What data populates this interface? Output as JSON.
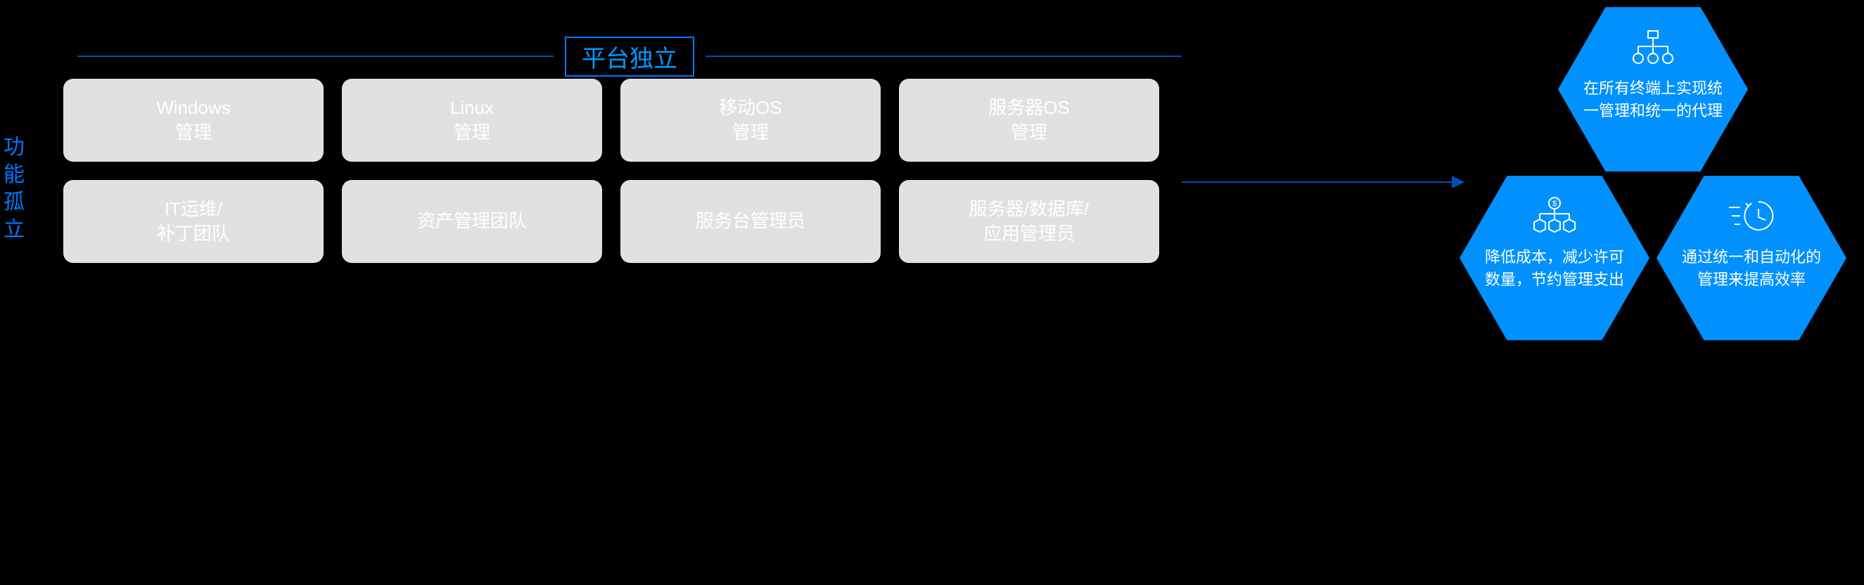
{
  "colors": {
    "accent_blue": "#0078ff",
    "bright_blue": "#0099ff",
    "line_blue": "#0050b3",
    "hex_blue": "#0091ff",
    "card_grey": "#e1e1e1",
    "bg_black": "#000000"
  },
  "sidebar": {
    "vertical_label": "功能孤立"
  },
  "heading": {
    "label": "平台独立"
  },
  "cards": {
    "row1": [
      {
        "line1": "Windows",
        "line2": "管理"
      },
      {
        "line1": "Linux",
        "line2": "管理"
      },
      {
        "line1": "移动OS",
        "line2": "管理"
      },
      {
        "line1": "服务器OS",
        "line2": "管理"
      }
    ],
    "row2": [
      {
        "line1": "IT运维/",
        "line2": "补丁团队"
      },
      {
        "line1": "资产管理团队",
        "line2": ""
      },
      {
        "line1": "服务台管理员",
        "line2": ""
      },
      {
        "line1": "服务器/数据库/",
        "line2": "应用管理员"
      }
    ]
  },
  "hex": {
    "top": {
      "icon": "org-chart-icon",
      "text": "在所有终端上实现统一管理和统一的代理"
    },
    "left": {
      "icon": "cost-boxes-icon",
      "text": "降低成本，减少许可数量，节约管理支出"
    },
    "right": {
      "icon": "speed-clock-icon",
      "text": "通过统一和自动化的管理来提高效率"
    }
  }
}
